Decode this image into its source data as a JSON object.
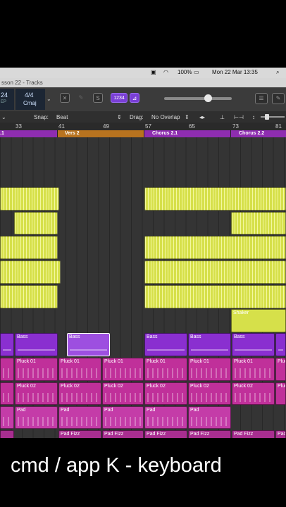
{
  "menubar": {
    "battery": "100%",
    "datetime": "Mon 22 Mar  13:35"
  },
  "window": {
    "title": "sson 22 - Tracks"
  },
  "lcd": {
    "bar": "24",
    "bar_sub": "EP",
    "timesig": "4/4",
    "key": "Cmaj"
  },
  "toolbar": {
    "count_in": "1234"
  },
  "controls": {
    "snap_label": "Snap:",
    "snap_value": "Beat",
    "drag_label": "Drag:",
    "drag_value": "No Overlap"
  },
  "ruler": {
    "bars": [
      "33",
      "41",
      "49",
      "57",
      "65",
      "73",
      "81"
    ]
  },
  "markers": [
    {
      "label": ".1",
      "color": "#8e2db0"
    },
    {
      "label": "Vers 2",
      "color": "#b8731f"
    },
    {
      "label": "Chorus 2.1",
      "color": "#8e2db0"
    },
    {
      "label": "Chorus 2.2",
      "color": "#8e2db0"
    }
  ],
  "regions": {
    "shaker": "Shaker",
    "bass": "Bass",
    "pluck1": "Pluck 01",
    "pluck2": "Pluck 02",
    "pad": "Pad",
    "fizz": "Pad Fizz"
  },
  "caption": "cmd / app K - keyboard",
  "colors": {
    "audio": "#d6e04a",
    "bass": "#8a2fd0",
    "pluck": "#c0309a",
    "pad": "#c43ca8",
    "marker_verse": "#b8731f"
  }
}
